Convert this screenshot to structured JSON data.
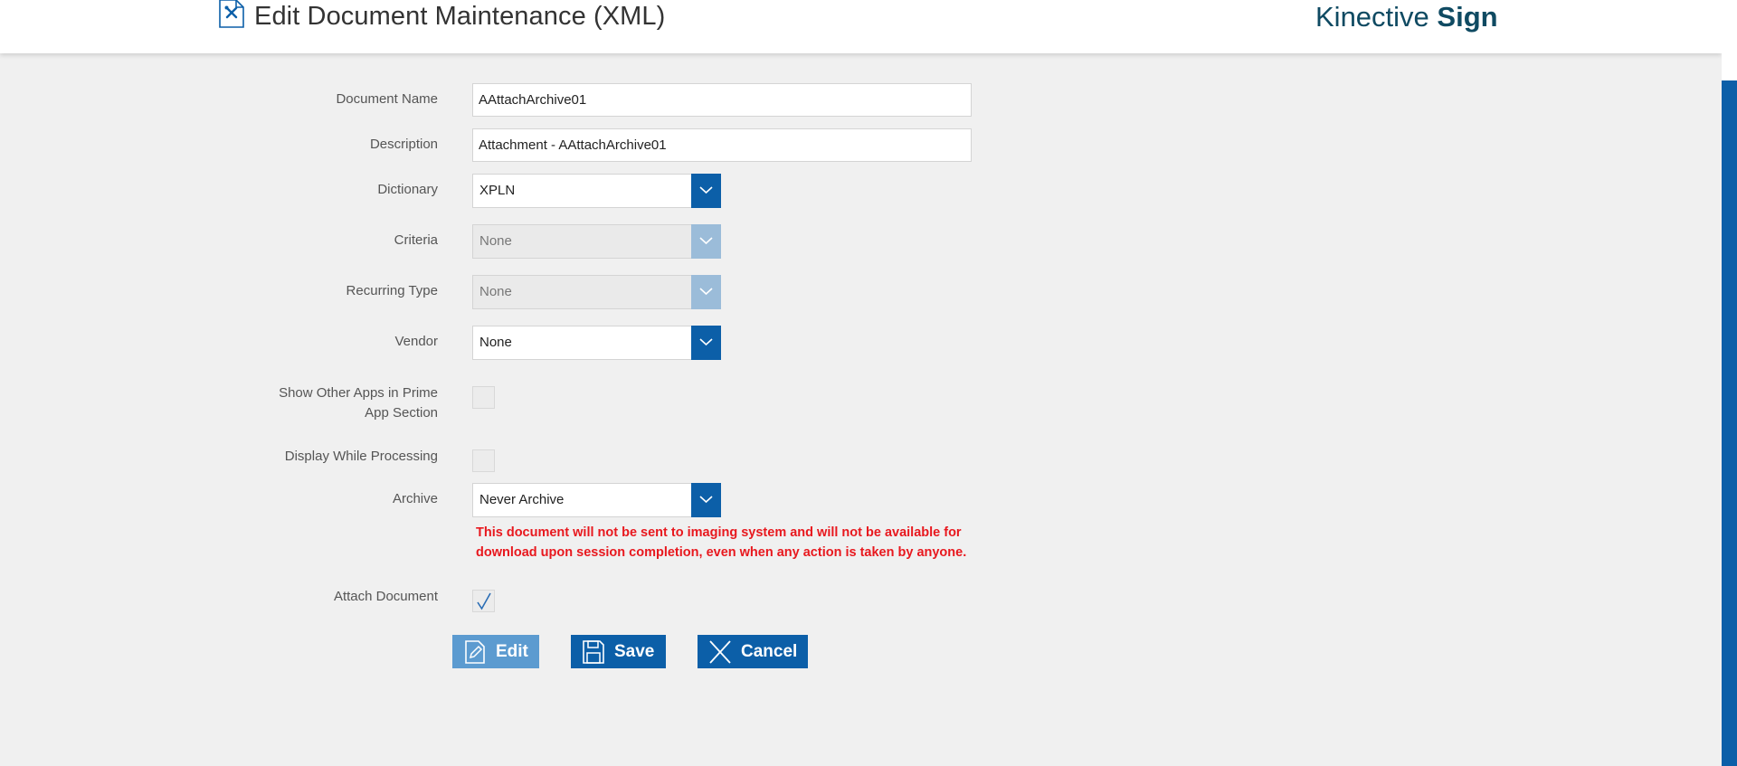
{
  "header": {
    "title": "Edit Document Maintenance (XML)",
    "brand_light": "Kinective ",
    "brand_bold": "Sign"
  },
  "form": {
    "document_name": {
      "label": "Document Name",
      "value": "AAttachArchive01"
    },
    "description": {
      "label": "Description",
      "value": "Attachment  - AAttachArchive01"
    },
    "dictionary": {
      "label": "Dictionary",
      "value": "XPLN"
    },
    "criteria": {
      "label": "Criteria",
      "value": "None",
      "disabled": true
    },
    "recurring_type": {
      "label": "Recurring Type",
      "value": "None",
      "disabled": true
    },
    "vendor": {
      "label": "Vendor",
      "value": "None"
    },
    "show_other_apps": {
      "label_line1": "Show Other Apps in Prime",
      "label_line2": "App Section",
      "checked": false
    },
    "display_while_processing": {
      "label": "Display While Processing",
      "checked": false
    },
    "archive": {
      "label": "Archive",
      "value": "Never Archive",
      "warning_line1": "This document will not be sent to imaging system and will not be available for",
      "warning_line2": "download upon session completion, even when any action is taken by anyone."
    },
    "attach_document": {
      "label": "Attach Document",
      "checked": true
    }
  },
  "actions": {
    "edit_label": "Edit",
    "save_label": "Save",
    "cancel_label": "Cancel"
  },
  "colors": {
    "primary": "#0c5fa8",
    "primary_disabled": "#9bbcd9",
    "edit_button": "#5c9bd0",
    "warning": "#e8181e",
    "brand_text": "#0f4a62"
  },
  "icons": {
    "header": "document-settings-icon",
    "dropdown": "chevron-down-icon",
    "edit": "pencil-icon",
    "save": "floppy-disk-icon",
    "cancel": "close-icon"
  }
}
